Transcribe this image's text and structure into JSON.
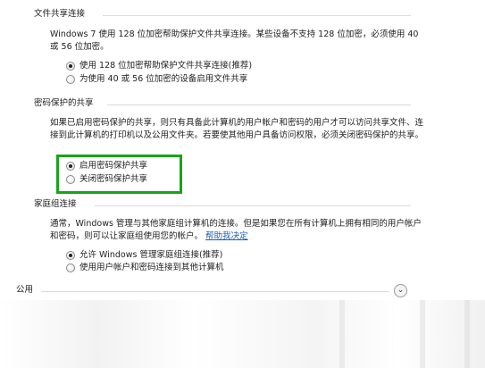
{
  "file_sharing": {
    "header": "文件共享连接",
    "description": "Windows 7 使用 128 位加密帮助保护文件共享连接。某些设备不支持 128 位加密，必须使用 40 或 56 位加密。",
    "options": [
      {
        "label": "使用 128 位加密帮助保护文件共享连接(推荐)",
        "checked": true
      },
      {
        "label": "为使用 40 或 56 位加密的设备启用文件共享",
        "checked": false
      }
    ]
  },
  "password_sharing": {
    "header": "密码保护的共享",
    "description": "如果已启用密码保护的共享，则只有具备此计算机的用户帐户和密码的用户才可以访问共享文件、连接到此计算机的打印机以及公用文件夹。若要使其他用户具备访问权限，必须关闭密码保护的共享。",
    "options": [
      {
        "label": "启用密码保护共享",
        "checked": true
      },
      {
        "label": "关闭密码保护共享",
        "checked": false
      }
    ],
    "highlight_color": "#18a418"
  },
  "homegroup": {
    "header": "家庭组连接",
    "description": "通常，Windows 管理与其他家庭组计算机的连接。但是如果您在所有计算机上拥有相同的用户帐户和密码，则可以让家庭组使用您的帐户。",
    "help_link": "帮助我决定",
    "options": [
      {
        "label": "允许 Windows 管理家庭组连接(推荐)",
        "checked": true
      },
      {
        "label": "使用用户帐户和密码连接到其他计算机",
        "checked": false
      }
    ]
  },
  "public": {
    "header": "公用",
    "expand_icon": "chevron-down-icon"
  }
}
